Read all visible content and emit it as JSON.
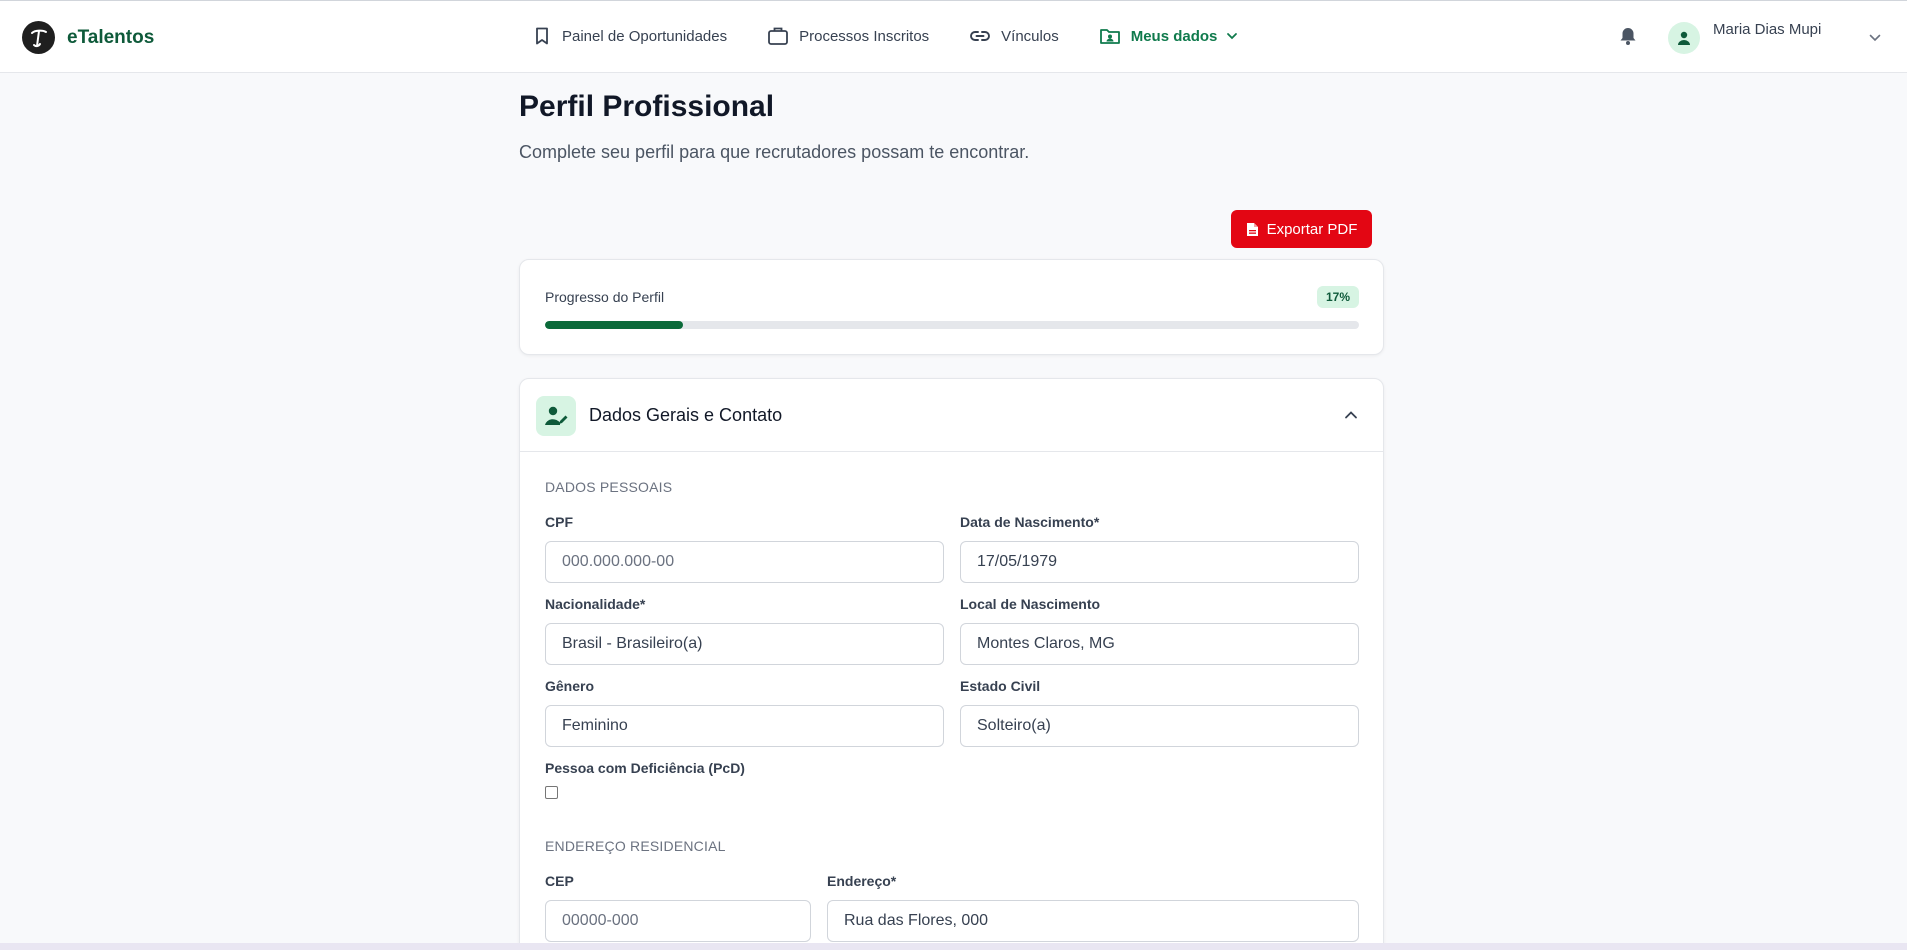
{
  "brand": {
    "name": "eTalentos"
  },
  "nav": {
    "items": [
      {
        "label": "Painel de Oportunidades",
        "icon": "bookmark-icon"
      },
      {
        "label": "Processos Inscritos",
        "icon": "briefcase-icon"
      },
      {
        "label": "Vínculos",
        "icon": "link-icon"
      },
      {
        "label": "Meus dados",
        "icon": "folder-user-icon",
        "active": true
      }
    ]
  },
  "user": {
    "name": "Maria Dias Mupi"
  },
  "page": {
    "title": "Perfil Profissional",
    "subtitle": "Complete seu perfil para que recrutadores possam te encontrar."
  },
  "export": {
    "label": "Exportar PDF"
  },
  "progress": {
    "label": "Progresso do Perfil",
    "percent_text": "17%",
    "value": 17
  },
  "section": {
    "title": "Dados Gerais e Contato"
  },
  "personal": {
    "heading": "DADOS PESSOAIS",
    "cpf": {
      "label": "CPF",
      "placeholder": "000.000.000-00"
    },
    "birth": {
      "label": "Data de Nascimento*",
      "value": "17/05/1979"
    },
    "nationality": {
      "label": "Nacionalidade*",
      "value": "Brasil - Brasileiro(a)"
    },
    "birthplace": {
      "label": "Local de Nascimento",
      "value": "Montes Claros, MG"
    },
    "gender": {
      "label": "Gênero",
      "value": "Feminino"
    },
    "marital": {
      "label": "Estado Civil",
      "value": "Solteiro(a)"
    },
    "pcd": {
      "label": "Pessoa com Deficiência (PcD)"
    }
  },
  "address": {
    "heading": "ENDEREÇO RESIDENCIAL",
    "cep": {
      "label": "CEP",
      "placeholder": "00000-000"
    },
    "street": {
      "label": "Endereço*",
      "value": "Rua das Flores, 000"
    }
  },
  "colors": {
    "brand_green": "#0e5a3a",
    "accent_red": "#e30613",
    "progress": "#0b6a3a"
  }
}
